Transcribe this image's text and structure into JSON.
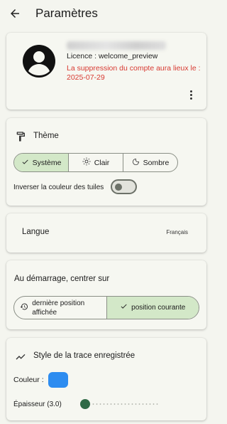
{
  "appbar": {
    "title": "Paramètres"
  },
  "account": {
    "username_hidden": "",
    "licence": "Licence : welcome_preview",
    "deletion_notice": "La suppression du compte aura lieux le : 2025-07-29"
  },
  "theme": {
    "title": "Thème",
    "options": [
      {
        "label": "Système",
        "icon": "check-icon",
        "selected": true
      },
      {
        "label": "Clair",
        "icon": "sun-icon",
        "selected": false
      },
      {
        "label": "Sombre",
        "icon": "moon-icon",
        "selected": false
      }
    ],
    "invert_tiles_label": "Inverser la couleur des tuiles",
    "invert_tiles_on": false
  },
  "language": {
    "label": "Langue",
    "value": "Français"
  },
  "startup": {
    "title": "Au démarrage, centrer sur",
    "options": [
      {
        "label": "dernière position affichée",
        "icon": "history-icon",
        "selected": false
      },
      {
        "label": "position courante",
        "icon": "check-icon",
        "selected": true
      }
    ]
  },
  "trace": {
    "title": "Style de la trace enregistrée",
    "color_label": "Couleur :",
    "color": "#2d8cf0",
    "thickness_label": "Épaisseur (3.0)",
    "thickness_value": 3.0
  },
  "colors": {
    "accent_selected": "#d3e8c8",
    "danger": "#d83a32",
    "slider_thumb": "#2f6a46"
  }
}
